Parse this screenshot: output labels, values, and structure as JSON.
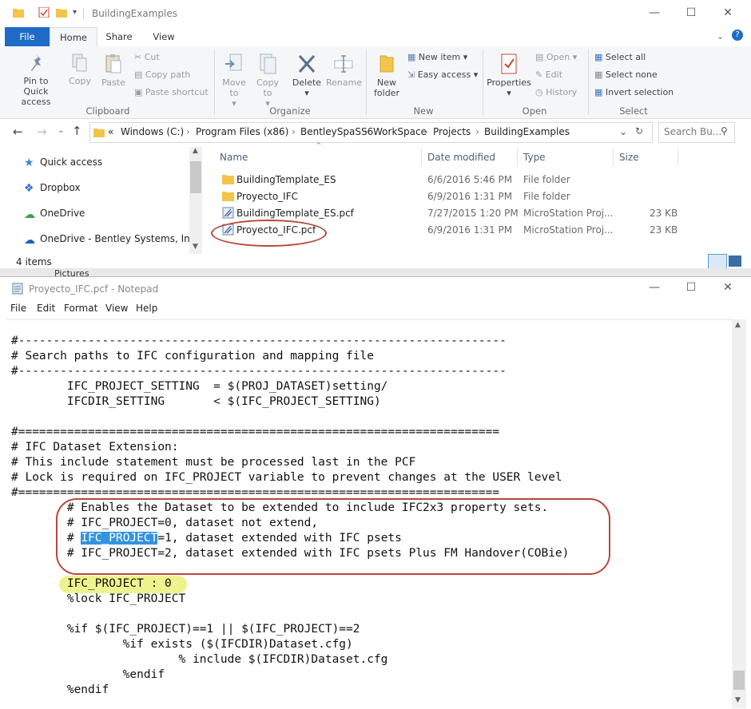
{
  "explorer": {
    "title": "BuildingExamples",
    "tabs": [
      "File",
      "Home",
      "Share",
      "View"
    ],
    "ribbon": {
      "clipboard": {
        "label": "Clipboard",
        "pin_to_quick_access": "Pin to Quick access",
        "copy": "Copy",
        "paste": "Paste",
        "cut": "Cut",
        "copy_path": "Copy path",
        "paste_shortcut": "Paste shortcut"
      },
      "organize": {
        "label": "Organize",
        "move_to": "Move to",
        "copy_to": "Copy to",
        "delete": "Delete",
        "rename": "Rename"
      },
      "new": {
        "label": "New",
        "new_folder": "New folder",
        "new_item": "New item",
        "easy_access": "Easy access"
      },
      "open": {
        "label": "Open",
        "properties": "Properties",
        "open": "Open",
        "edit": "Edit",
        "history": "History"
      },
      "select": {
        "label": "Select",
        "select_all": "Select all",
        "select_none": "Select none",
        "invert_selection": "Invert selection"
      }
    },
    "address": {
      "prefix": "«",
      "crumbs": [
        "Windows (C:)",
        "Program Files (x86)",
        "BentleySpaSS6",
        "WorkSpace",
        "Projects",
        "BuildingExamples"
      ],
      "search_placeholder": "Search Bu..."
    },
    "nav": [
      "Quick access",
      "Dropbox",
      "OneDrive",
      "OneDrive - Bentley Systems, Inc"
    ],
    "columns": [
      "Name",
      "Date modified",
      "Type",
      "Size"
    ],
    "files": [
      {
        "name": "BuildingTemplate_ES",
        "date": "6/6/2016 5:46 PM",
        "type": "File folder",
        "size": ""
      },
      {
        "name": "Proyecto_IFC",
        "date": "6/9/2016 1:31 PM",
        "type": "File folder",
        "size": ""
      },
      {
        "name": "BuildingTemplate_ES.pcf",
        "date": "7/27/2015 1:20 PM",
        "type": "MicroStation Proj...",
        "size": "23 KB"
      },
      {
        "name": "Proyecto_IFC.pcf",
        "date": "6/9/2016 1:31 PM",
        "type": "MicroStation Proj...",
        "size": "23 KB"
      }
    ],
    "status": "4 items",
    "behind_window_text": "Pictures"
  },
  "notepad": {
    "title": "Proyecto_IFC.pcf - Notepad",
    "menu": [
      "File",
      "Edit",
      "Format",
      "View",
      "Help"
    ],
    "lines": [
      "#----------------------------------------------------------------------",
      "# Search paths to IFC configuration and mapping file",
      "#----------------------------------------------------------------------",
      "        IFC_PROJECT_SETTING  = $(PROJ_DATASET)setting/",
      "        IFCDIR_SETTING       < $(IFC_PROJECT_SETTING)",
      "",
      "#=====================================================================",
      "# IFC Dataset Extension:",
      "# This include statement must be processed last in the PCF",
      "# Lock is required on IFC_PROJECT variable to prevent changes at the USER level",
      "#=====================================================================",
      "        # Enables the Dataset to be extended to include IFC2x3 property sets.",
      "        # IFC_PROJECT=0, dataset not extend,",
      "        # IFC_PROJECT=1, dataset extended with IFC psets",
      "        # IFC_PROJECT=2, dataset extended with IFC psets Plus FM Handover(COBie)",
      "",
      "        IFC_PROJECT : 0",
      "        %lock IFC_PROJECT",
      "",
      "        %if $(IFC_PROJECT)==1 || $(IFC_PROJECT)==2",
      "                %if exists ($(IFCDIR)Dataset.cfg)",
      "                        % include $(IFCDIR)Dataset.cfg",
      "                %endif",
      "        %endif"
    ],
    "selected_word": "IFC_PROJECT",
    "line13_rest": "=1, dataset extended with IFC psets",
    "line13_prefix": "        # "
  },
  "colors": {
    "file_tab": "#1e6cc8",
    "selection": "#3393df",
    "annotation_red": "#b8483a",
    "annotation_yellow": "#e8ef6a"
  }
}
